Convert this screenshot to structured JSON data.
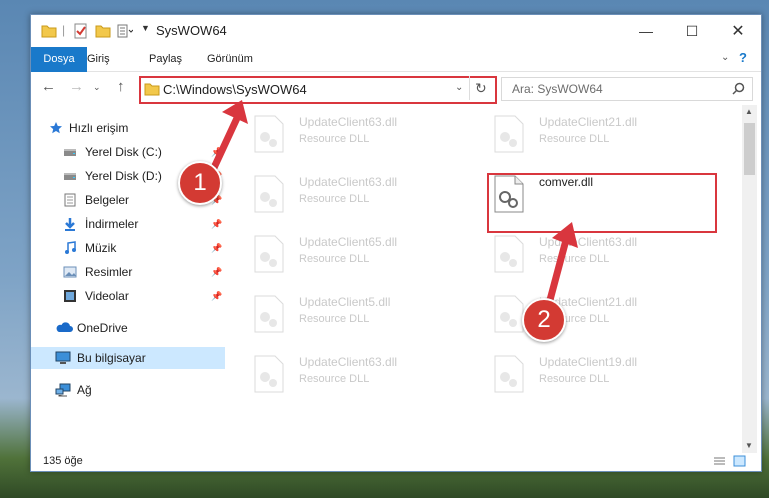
{
  "window": {
    "title": "SysWOW64"
  },
  "ribbon": {
    "tabs": [
      "Dosya",
      "Giriş",
      "Paylaş",
      "Görünüm"
    ]
  },
  "address": {
    "path": "C:\\Windows\\SysWOW64"
  },
  "search": {
    "placeholder": "Ara: SysWOW64"
  },
  "sidebar": {
    "items": [
      {
        "label": "Hızlı erişim",
        "icon": "star-icon"
      },
      {
        "label": "Yerel Disk (C:)",
        "icon": "drive-icon"
      },
      {
        "label": "Yerel Disk (D:)",
        "icon": "drive-icon"
      },
      {
        "label": "Belgeler",
        "icon": "documents-icon"
      },
      {
        "label": "İndirmeler",
        "icon": "download-icon"
      },
      {
        "label": "Müzik",
        "icon": "music-icon"
      },
      {
        "label": "Resimler",
        "icon": "pictures-icon"
      },
      {
        "label": "Videolar",
        "icon": "video-icon"
      },
      {
        "label": "OneDrive",
        "icon": "cloud-icon"
      },
      {
        "label": "Bu bilgisayar",
        "icon": "computer-icon"
      },
      {
        "label": "Ağ",
        "icon": "network-icon"
      }
    ]
  },
  "files": [
    {
      "name": "UpdateClient63.dll",
      "type": "Resource DLL"
    },
    {
      "name": "UpdateClient21.dll",
      "type": "Resource DLL"
    },
    {
      "name": "UpdateClient63.dll",
      "type": "Resource DLL"
    },
    {
      "name": "comver.dll",
      "type": ""
    },
    {
      "name": "UpdateClient65.dll",
      "type": "Resource DLL"
    },
    {
      "name": "UpdateClient63.dll",
      "type": "Resource DLL"
    },
    {
      "name": "UpdateClient5.dll",
      "type": "Resource DLL"
    },
    {
      "name": "UpdateClient21.dll",
      "type": "Resource DLL"
    },
    {
      "name": "UpdateClient63.dll",
      "type": "Resource DLL"
    },
    {
      "name": "UpdateClient19.dll",
      "type": "Resource DLL"
    }
  ],
  "status": {
    "count": "135 öğe"
  },
  "annotations": {
    "step1": "1",
    "step2": "2"
  },
  "colors": {
    "accent": "#1979ca",
    "highlight": "#d9363e",
    "badge": "#d33a33"
  }
}
